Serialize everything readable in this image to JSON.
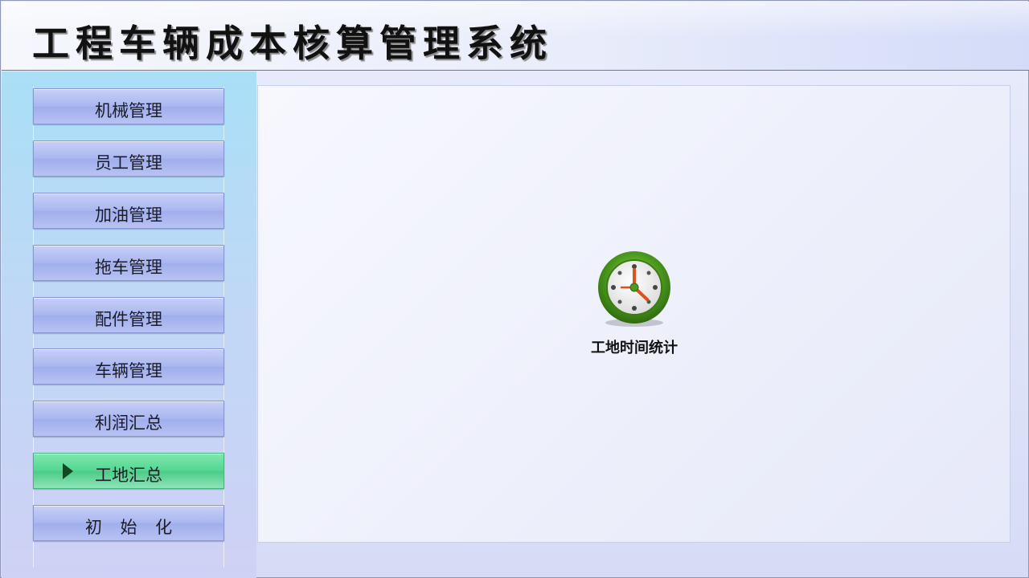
{
  "app": {
    "title": "工程车辆成本核算管理系统"
  },
  "sidebar": {
    "items": [
      {
        "label": "机械管理",
        "active": false
      },
      {
        "label": "员工管理",
        "active": false
      },
      {
        "label": "加油管理",
        "active": false
      },
      {
        "label": "拖车管理",
        "active": false
      },
      {
        "label": "配件管理",
        "active": false
      },
      {
        "label": "车辆管理",
        "active": false
      },
      {
        "label": "利润汇总",
        "active": false
      },
      {
        "label": "工地汇总",
        "active": true
      },
      {
        "label": "初 始 化",
        "active": false
      }
    ]
  },
  "main": {
    "tile": {
      "label": "工地时间统计",
      "icon": "clock-icon"
    }
  },
  "colors": {
    "nav_button": "#a9b6f0",
    "nav_active": "#53d690",
    "active_arrow": "#0f4a22",
    "clock_ring": "#4c9a1f",
    "clock_hand": "#e0521c"
  }
}
